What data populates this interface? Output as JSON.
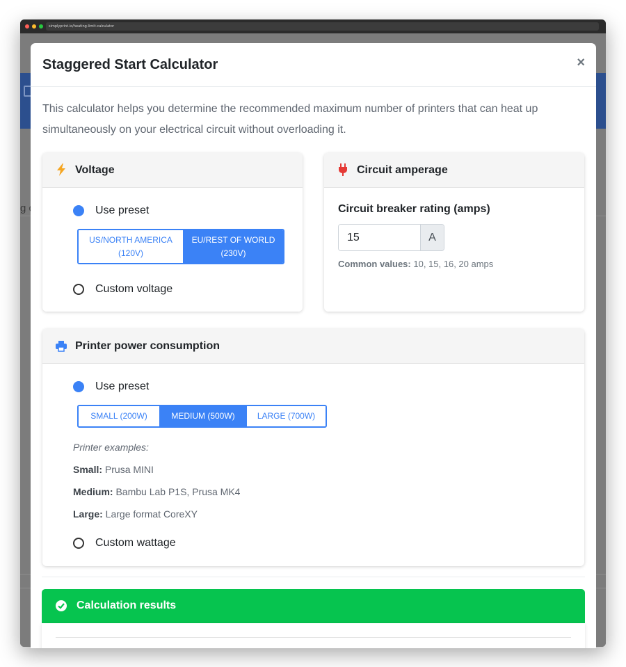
{
  "browser": {
    "url": "simplyprint.io/heating-limit-calculator"
  },
  "background": {
    "partial_text": "g c"
  },
  "modal": {
    "title": "Staggered Start Calculator",
    "close_label": "×",
    "intro": "This calculator helps you determine the recommended maximum number of printers that can heat up simultaneously on your electrical circuit without overloading it."
  },
  "voltage": {
    "title": "Voltage",
    "icon": "lightning-icon",
    "preset_label": "Use preset",
    "preset_checked": true,
    "options": [
      {
        "label": "US/NORTH AMERICA",
        "sub": "(120V)",
        "active": false
      },
      {
        "label": "EU/REST OF WORLD",
        "sub": "(230V)",
        "active": true
      }
    ],
    "custom_label": "Custom voltage"
  },
  "amperage": {
    "title": "Circuit amperage",
    "icon": "plug-icon",
    "field_label": "Circuit breaker rating (amps)",
    "value": "15",
    "unit": "A",
    "help_label": "Common values:",
    "help_text": " 10, 15, 16, 20 amps"
  },
  "power": {
    "title": "Printer power consumption",
    "icon": "printer-icon",
    "preset_label": "Use preset",
    "options": [
      {
        "label": "SMALL (200W)",
        "active": false
      },
      {
        "label": "MEDIUM (500W)",
        "active": true
      },
      {
        "label": "LARGE (700W)",
        "active": false
      }
    ],
    "examples_heading": "Printer examples:",
    "examples": [
      {
        "size": "Small:",
        "text": " Prusa MINI"
      },
      {
        "size": "Medium:",
        "text": " Bambu Lab P1S, Prusa MK4"
      },
      {
        "size": "Large:",
        "text": " Large format CoreXY"
      }
    ],
    "custom_label": "Custom wattage"
  },
  "results": {
    "title": "Calculation results",
    "icon": "check-circle-icon"
  },
  "colors": {
    "accent": "#3b82f6",
    "success": "#06c44f",
    "warning": "#f5a623",
    "danger": "#e53935"
  }
}
